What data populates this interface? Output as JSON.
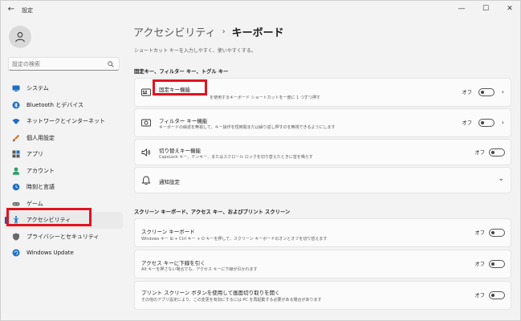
{
  "window": {
    "title": "設定",
    "controls": [
      "—",
      "☐",
      "✕"
    ]
  },
  "sidebar": {
    "search_placeholder": "設定の検索",
    "items": [
      {
        "label": "システム",
        "icon": "system-icon",
        "color": "#1f6fc4"
      },
      {
        "label": "Bluetooth とデバイス",
        "icon": "bluetooth-icon",
        "color": "#1f6fc4"
      },
      {
        "label": "ネットワークとインターネット",
        "icon": "wifi-icon",
        "color": "#1f6fc4"
      },
      {
        "label": "個人用設定",
        "icon": "brush-icon",
        "color": "#d67b2f"
      },
      {
        "label": "アプリ",
        "icon": "apps-icon",
        "color": "#5a5a5a"
      },
      {
        "label": "アカウント",
        "icon": "account-icon",
        "color": "#28a06b"
      },
      {
        "label": "時刻と言語",
        "icon": "globe-clock-icon",
        "color": "#1f6fc4"
      },
      {
        "label": "ゲーム",
        "icon": "gamepad-icon",
        "color": "#6a6a6a"
      },
      {
        "label": "アクセシビリティ",
        "icon": "accessibility-icon",
        "color": "#1f6fc4",
        "active": true
      },
      {
        "label": "プライバシーとセキュリティ",
        "icon": "shield-icon",
        "color": "#6a6a6a"
      },
      {
        "label": "Windows Update",
        "icon": "update-icon",
        "color": "#1f6fc4"
      }
    ]
  },
  "main": {
    "breadcrumb_parent": "アクセシビリティ",
    "breadcrumb_sep": "›",
    "breadcrumb_current": "キーボード",
    "subtitle": "ショートカット キーを入力しやすく、使いやすくする。",
    "sections": [
      {
        "heading": "固定キー、フィルター キー、トグル キー",
        "cards": [
          {
            "title": "固定キー機能",
            "desc": "を使用するキーボード ショートカットを一度に 1 つずつ押す",
            "state": "オフ",
            "toggle": "off",
            "chevron": true,
            "icon": "sticky-keys-icon"
          },
          {
            "title": "フィルター キー機能",
            "desc": "キーボードの繰返を無視して、キー操作を短時間または繰り返し押すのを無視できるようにします",
            "state": "オフ",
            "toggle": "off",
            "chevron": true,
            "icon": "filter-keys-icon"
          },
          {
            "title": "切り替えキー機能",
            "desc": "CapsLock キー、テンキー、またはスクロール ロックを切り替えたときに音を鳴らす",
            "state": "オフ",
            "toggle": "off",
            "chevron": false,
            "icon": "speaker-icon"
          },
          {
            "title": "通知設定",
            "desc": "",
            "state": "",
            "toggle": "",
            "chevron": false,
            "expand": "⌄",
            "icon": "bell-icon"
          }
        ]
      },
      {
        "heading": "スクリーン キーボード、アクセス キー、およびプリント スクリーン",
        "cards": [
          {
            "title": "スクリーン キーボード",
            "desc": "Windows キー ⊞ + Ctrl キー + O キーを押して、スクリーン キーボードのオンとオフを切り替えます",
            "state": "オフ",
            "toggle": "off",
            "chevron": false
          },
          {
            "title": "アクセス キーに下線を引く",
            "desc": "Alt キーを押さない場合でも、アクセス キーに下線が引かれます",
            "state": "オフ",
            "toggle": "off",
            "chevron": false
          },
          {
            "title": "プリント スクリーン ボタンを使用して画面切り取りを開く",
            "desc": "その他のアプリ設定により、この変更を有効にするには PC を再起動する必要がある場合があります",
            "state": "オフ",
            "toggle": "off",
            "chevron": false
          }
        ]
      }
    ]
  },
  "colors": {
    "highlight_box": "#e3121f",
    "accent": "#005fb8"
  }
}
